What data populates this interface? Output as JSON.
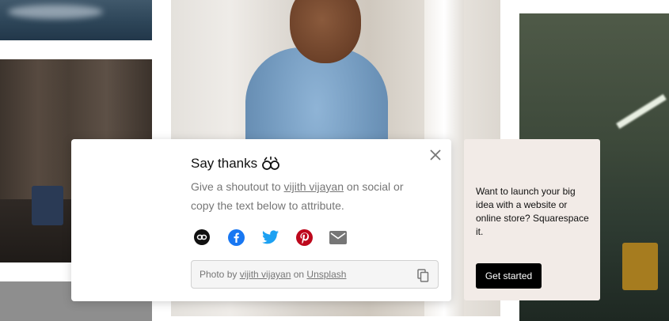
{
  "modal": {
    "title": "Say thanks",
    "title_icon": "hands-clap-icon",
    "body_prefix": "Give a shoutout to ",
    "photographer": "vijith vijayan",
    "body_suffix": " on social or copy the text below to attribute.",
    "share_icons": [
      "link-icon",
      "facebook-icon",
      "twitter-icon",
      "pinterest-icon",
      "email-icon"
    ],
    "attribution": {
      "prefix": "Photo by ",
      "photographer": "vijith vijayan",
      "middle": " on ",
      "site": "Unsplash"
    },
    "colors": {
      "facebook": "#1877f2",
      "twitter": "#1da1f2",
      "pinterest": "#bd081c",
      "icon_dark": "#111111",
      "icon_gray": "#767676"
    }
  },
  "ad": {
    "text": "Want to launch your big idea with a website or online store? Squarespace it.",
    "button_label": "Get started",
    "background": "#f2ebe7"
  }
}
